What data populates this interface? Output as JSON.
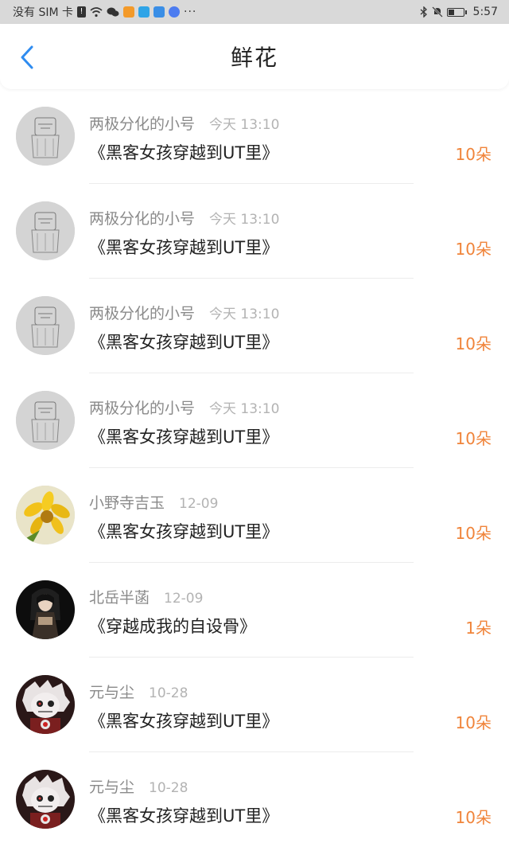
{
  "status_bar": {
    "carrier": "没有 SIM 卡",
    "time": "5:57"
  },
  "header": {
    "title": "鲜花"
  },
  "items": [
    {
      "name": "两极分化的小号",
      "time": "今天 13:10",
      "title": "《黑客女孩穿越到UT里》",
      "count": "10朵",
      "avatar": "sketch-avatar"
    },
    {
      "name": "两极分化的小号",
      "time": "今天 13:10",
      "title": "《黑客女孩穿越到UT里》",
      "count": "10朵",
      "avatar": "sketch-avatar"
    },
    {
      "name": "两极分化的小号",
      "time": "今天 13:10",
      "title": "《黑客女孩穿越到UT里》",
      "count": "10朵",
      "avatar": "sketch-avatar"
    },
    {
      "name": "两极分化的小号",
      "time": "今天 13:10",
      "title": "《黑客女孩穿越到UT里》",
      "count": "10朵",
      "avatar": "sketch-avatar"
    },
    {
      "name": "小野寺吉玉",
      "time": "12-09",
      "title": "《黑客女孩穿越到UT里》",
      "count": "10朵",
      "avatar": "flower-avatar"
    },
    {
      "name": "北岳半菡",
      "time": "12-09",
      "title": "《穿越成我的自设骨》",
      "count": "1朵",
      "avatar": "character-avatar"
    },
    {
      "name": "元与尘",
      "time": "10-28",
      "title": "《黑客女孩穿越到UT里》",
      "count": "10朵",
      "avatar": "skull-avatar"
    },
    {
      "name": "元与尘",
      "time": "10-28",
      "title": "《黑客女孩穿越到UT里》",
      "count": "10朵",
      "avatar": "skull-avatar"
    }
  ],
  "colors": {
    "accent": "#2f8cf0",
    "count": "#f0843a"
  }
}
